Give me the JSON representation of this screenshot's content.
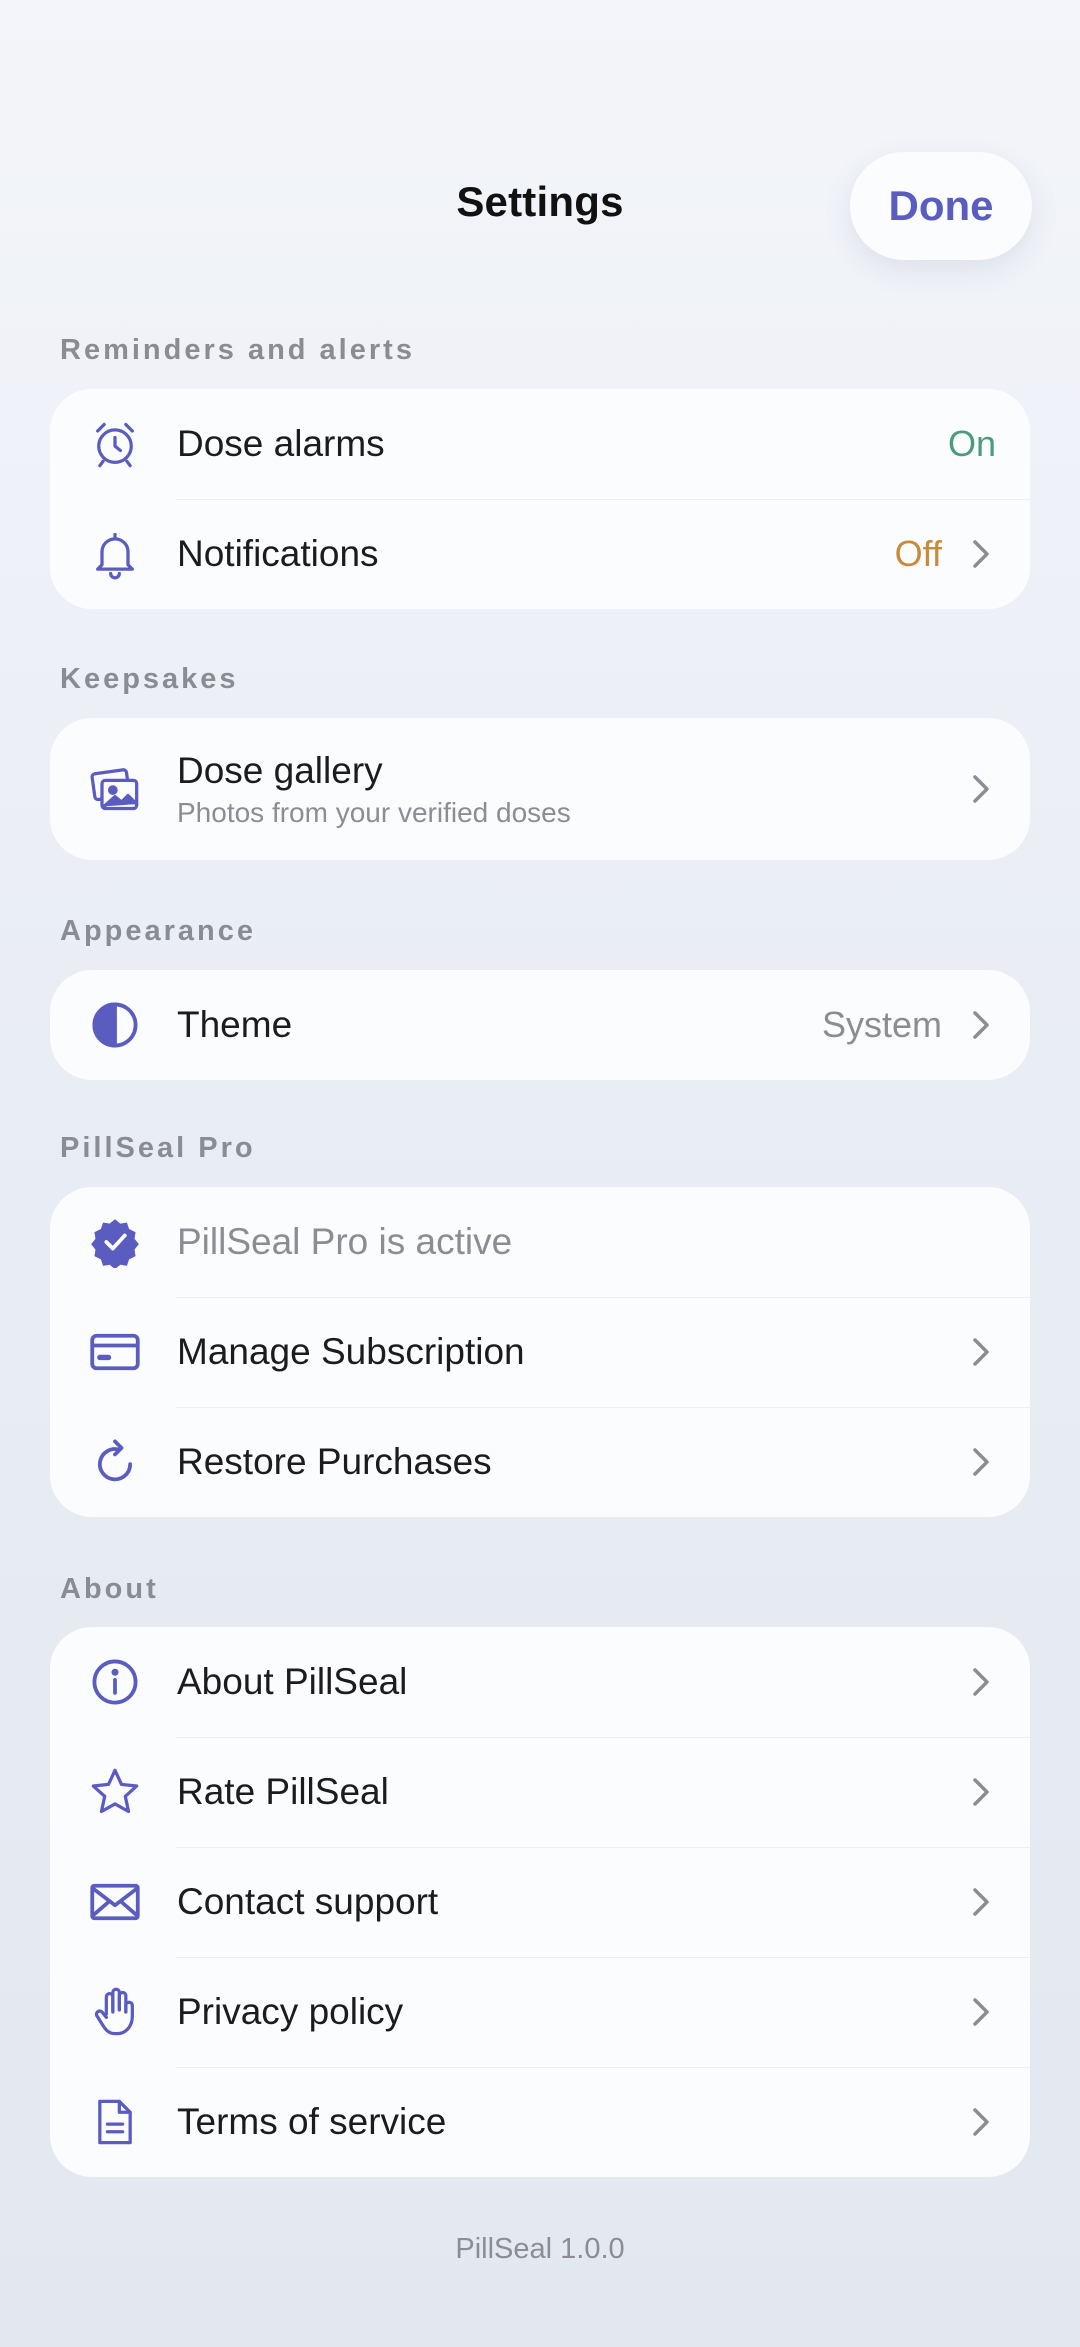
{
  "header": {
    "title": "Settings",
    "done_label": "Done"
  },
  "colors": {
    "accent": "#5a5cc0",
    "on": "#4d9b7d",
    "off": "#c98a3b",
    "muted": "#8b8d93"
  },
  "sections": {
    "reminders": {
      "label": "Reminders and alerts",
      "items": [
        {
          "icon": "alarm-clock-icon",
          "label": "Dose alarms",
          "value": "On"
        },
        {
          "icon": "bell-icon",
          "label": "Notifications",
          "value": "Off"
        }
      ]
    },
    "keepsakes": {
      "label": "Keepsakes",
      "items": [
        {
          "icon": "photo-gallery-icon",
          "label": "Dose gallery",
          "sublabel": "Photos from your verified doses"
        }
      ]
    },
    "appearance": {
      "label": "Appearance",
      "items": [
        {
          "icon": "half-circle-theme-icon",
          "label": "Theme",
          "value": "System"
        }
      ]
    },
    "pro": {
      "label": "PillSeal Pro",
      "items": [
        {
          "icon": "verified-badge-icon",
          "label": "PillSeal Pro is active"
        },
        {
          "icon": "credit-card-icon",
          "label": "Manage Subscription"
        },
        {
          "icon": "refresh-icon",
          "label": "Restore Purchases"
        }
      ]
    },
    "about": {
      "label": "About",
      "items": [
        {
          "icon": "info-icon",
          "label": "About PillSeal"
        },
        {
          "icon": "star-icon",
          "label": "Rate PillSeal"
        },
        {
          "icon": "envelope-icon",
          "label": "Contact support"
        },
        {
          "icon": "hand-icon",
          "label": "Privacy policy"
        },
        {
          "icon": "document-icon",
          "label": "Terms of service"
        }
      ]
    }
  },
  "footer": {
    "version": "PillSeal 1.0.0"
  }
}
